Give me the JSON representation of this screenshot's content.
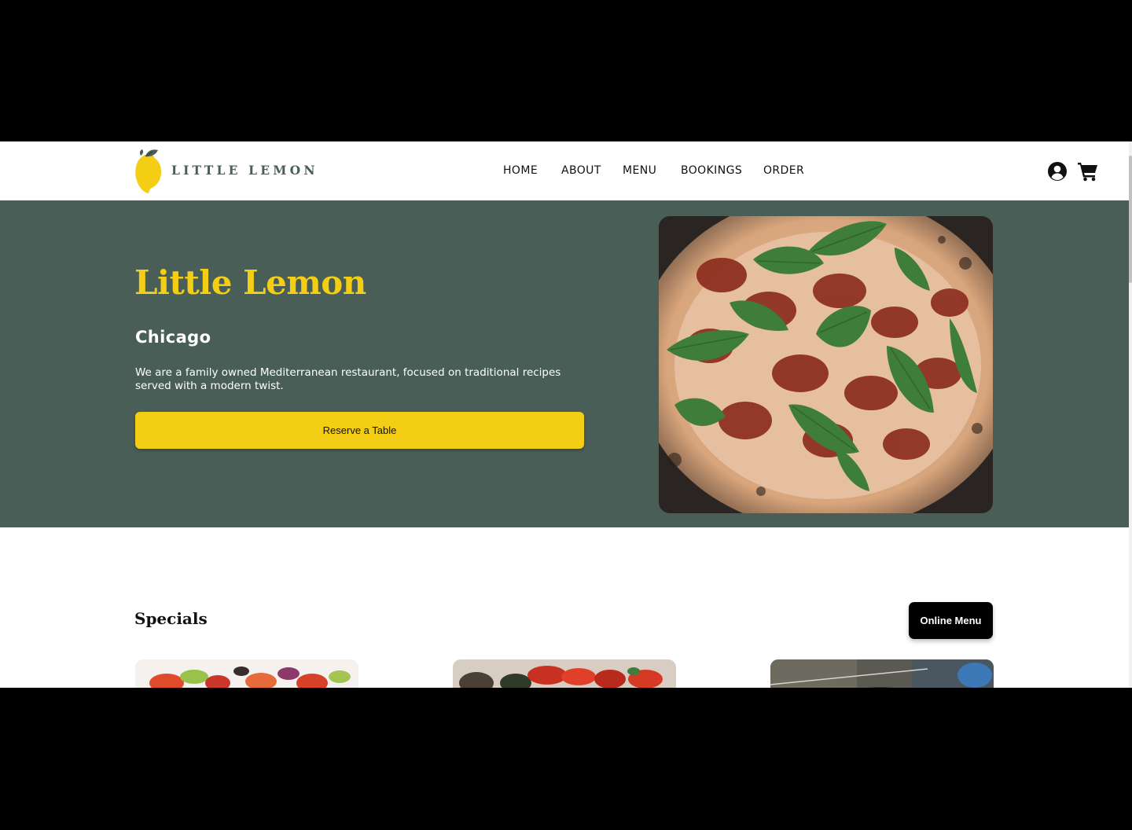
{
  "brand": {
    "name": "LITTLE LEMON",
    "icon": "lemon-icon",
    "colors": {
      "green": "#495e57",
      "yellow": "#f4ce14",
      "black": "#000000"
    }
  },
  "nav": {
    "items": [
      {
        "label": "HOME"
      },
      {
        "label": "ABOUT"
      },
      {
        "label": "MENU"
      },
      {
        "label": "BOOKINGS"
      },
      {
        "label": "ORDER"
      }
    ]
  },
  "header_icons": {
    "account": "user-circle-icon",
    "cart": "shopping-cart-icon"
  },
  "hero": {
    "title": "Little Lemon",
    "subtitle": "Chicago",
    "description": "We are a family owned Mediterranean restaurant, focused on traditional recipes served with a modern twist.",
    "cta_label": "Reserve a Table",
    "image": "pizza-photo"
  },
  "specials": {
    "title": "Specials",
    "button_label": "Online Menu",
    "cards": [
      {
        "image": "greek-salad-photo"
      },
      {
        "image": "bruschetta-photo"
      },
      {
        "image": "lemon-dessert-photo"
      }
    ]
  }
}
